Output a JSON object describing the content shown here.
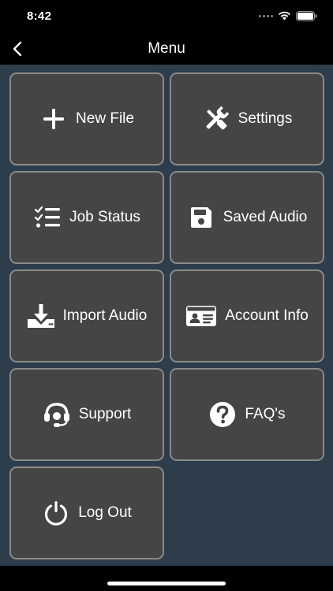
{
  "status_bar": {
    "time": "8:42"
  },
  "nav": {
    "title": "Menu",
    "back_icon": "chevron-left-icon"
  },
  "menu": {
    "items": [
      {
        "label": "New File",
        "icon": "plus-icon"
      },
      {
        "label": "Settings",
        "icon": "tools-icon"
      },
      {
        "label": "Job Status",
        "icon": "checklist-icon"
      },
      {
        "label": "Saved Audio",
        "icon": "floppy-disk-icon"
      },
      {
        "label": "Import Audio",
        "icon": "download-icon"
      },
      {
        "label": "Account Info",
        "icon": "id-card-icon"
      },
      {
        "label": "Support",
        "icon": "headset-icon"
      },
      {
        "label": "FAQ's",
        "icon": "question-circle-icon"
      },
      {
        "label": "Log Out",
        "icon": "power-icon"
      }
    ]
  },
  "colors": {
    "background": "#2e3d4c",
    "tile": "#454545",
    "tile_border": "#8a8a8a",
    "bars": "#000000",
    "text": "#ffffff"
  }
}
